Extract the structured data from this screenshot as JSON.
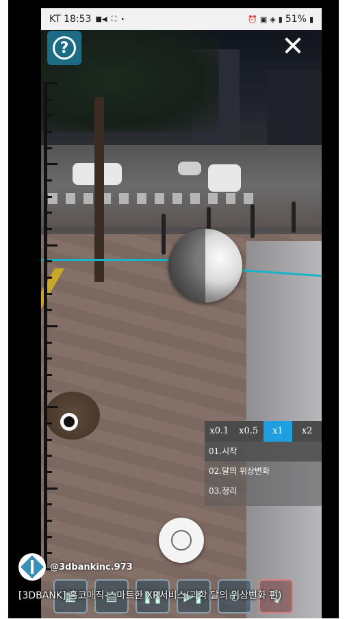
{
  "status_bar": {
    "carrier_time": "KT 18:53",
    "battery": "51%",
    "left_icons": [
      "video-icon",
      "screenshot-icon",
      "dot-icon"
    ],
    "right_icons": [
      "alarm-icon",
      "nfc-icon",
      "wifi-icon",
      "signal-icon",
      "battery-icon"
    ]
  },
  "top_buttons": {
    "help_symbol": "?",
    "close_symbol": "✕"
  },
  "speed_options": [
    {
      "label": "x0.1",
      "active": false
    },
    {
      "label": "x0.5",
      "active": false
    },
    {
      "label": "x1",
      "active": true
    },
    {
      "label": "x2",
      "active": false
    }
  ],
  "steps": [
    {
      "label": "01.시작",
      "active": true
    },
    {
      "label": "02.달의 위상변화",
      "active": false
    },
    {
      "label": "03.정리",
      "active": false
    }
  ],
  "channel": {
    "handle": "@3dbankinc.973"
  },
  "caption": "[3DBANK] 홈코매직-스마트한 XR서비스(과학 달의 위상변화 편)",
  "colors": {
    "help_button": "#1d6c86",
    "guide_line": "#19b3c9",
    "active_speed": "#1f9fe0"
  }
}
